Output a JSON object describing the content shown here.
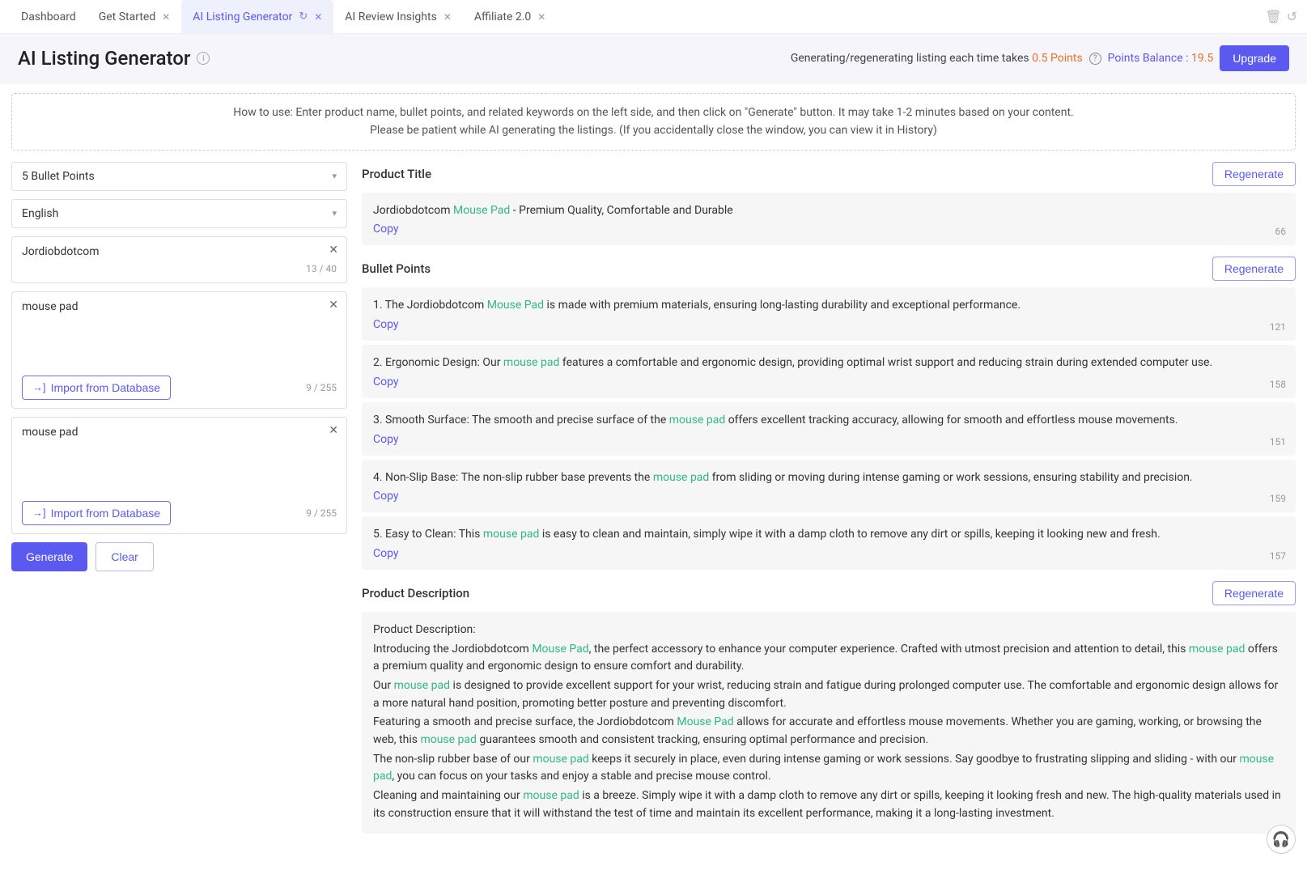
{
  "tabs": [
    {
      "label": "Dashboard",
      "closable": false,
      "active": false
    },
    {
      "label": "Get Started",
      "closable": true,
      "active": false
    },
    {
      "label": "AI Listing Generator",
      "closable": true,
      "active": true,
      "refresh": true
    },
    {
      "label": "AI Review Insights",
      "closable": true,
      "active": false
    },
    {
      "label": "Affiliate 2.0",
      "closable": true,
      "active": false
    }
  ],
  "page": {
    "title": "AI Listing Generator"
  },
  "balance": {
    "prefix": "Generating/regenerating listing each time takes ",
    "cost": "0.5 Points",
    "balance_label": " Points Balance : ",
    "balance_value": "19.5",
    "upgrade": "Upgrade"
  },
  "howto": {
    "line1": "How to use: Enter product name, bullet points, and related keywords on the left side, and then click on \"Generate\" button. It may take 1-2 minutes based on your content.",
    "line2": "Please be patient while AI generating the listings. (If you accidentally close the window, you can view it in History)"
  },
  "left": {
    "bullet_select": "5 Bullet Points",
    "lang_select": "English",
    "brand": {
      "value": "Jordiobdotcom",
      "count": "13 / 40"
    },
    "bullet_kw": {
      "value": "mouse pad",
      "count": "9 / 255",
      "import": "Import from Database"
    },
    "backend_kw": {
      "value": "mouse pad",
      "count": "9 / 255",
      "import": "Import from Database"
    },
    "generate": "Generate",
    "clear": "Clear"
  },
  "results": {
    "title_section": "Product Title",
    "regenerate": "Regenerate",
    "copy": "Copy",
    "title": {
      "pre": "Jordiobdotcom ",
      "hl": "Mouse Pad",
      "post": " - Premium Quality, Comfortable and Durable",
      "count": "66"
    },
    "bullets_section": "Bullet Points",
    "bullets": [
      {
        "pre": "1. The Jordiobdotcom ",
        "hl": "Mouse Pad",
        "post": " is made with premium materials, ensuring long-lasting durability and exceptional performance.",
        "count": "121"
      },
      {
        "pre": "2. Ergonomic Design: Our ",
        "hl": "mouse pad",
        "post": " features a comfortable and ergonomic design, providing optimal wrist support and reducing strain during extended computer use.",
        "count": "158"
      },
      {
        "pre": "3. Smooth Surface: The smooth and precise surface of the ",
        "hl": "mouse pad",
        "post": " offers excellent tracking accuracy, allowing for smooth and effortless mouse movements.",
        "count": "151"
      },
      {
        "pre": "4. Non-Slip Base: The non-slip rubber base prevents the ",
        "hl": "mouse pad",
        "post": " from sliding or moving during intense gaming or work sessions, ensuring stability and precision.",
        "count": "159"
      },
      {
        "pre": "5. Easy to Clean: This ",
        "hl": "mouse pad",
        "post": " is easy to clean and maintain, simply wipe it with a damp cloth to remove any dirt or spills, keeping it looking new and fresh.",
        "count": "157"
      }
    ],
    "desc_section": "Product Description",
    "description": {
      "heading": "Product Description:",
      "p1a": "Introducing the Jordiobdotcom ",
      "p1h1": "Mouse Pad",
      "p1b": ", the perfect accessory to enhance your computer experience. Crafted with utmost precision and attention to detail, this ",
      "p1h2": "mouse pad",
      "p1c": " offers a premium quality and ergonomic design to ensure comfort and durability.",
      "p2a": "Our ",
      "p2h": "mouse pad",
      "p2b": " is designed to provide excellent support for your wrist, reducing strain and fatigue during prolonged computer use. The comfortable and ergonomic design allows for a more natural hand position, promoting better posture and preventing discomfort.",
      "p3a": "Featuring a smooth and precise surface, the Jordiobdotcom ",
      "p3h1": "Mouse Pad",
      "p3b": " allows for accurate and effortless mouse movements. Whether you are gaming, working, or browsing the web, this ",
      "p3h2": "mouse pad",
      "p3c": " guarantees smooth and consistent tracking, ensuring optimal performance and precision.",
      "p4a": "The non-slip rubber base of our ",
      "p4h1": "mouse pad",
      "p4b": " keeps it securely in place, even during intense gaming or work sessions. Say goodbye to frustrating slipping and sliding - with our ",
      "p4h2": "mouse pad",
      "p4c": ", you can focus on your tasks and enjoy a stable and precise mouse control.",
      "p5a": "Cleaning and maintaining our ",
      "p5h": "mouse pad",
      "p5b": " is a breeze. Simply wipe it with a damp cloth to remove any dirt or spills, keeping it looking fresh and new. The high-quality materials used in its construction ensure that it will withstand the test of time and maintain its excellent performance, making it a long-lasting investment."
    }
  }
}
